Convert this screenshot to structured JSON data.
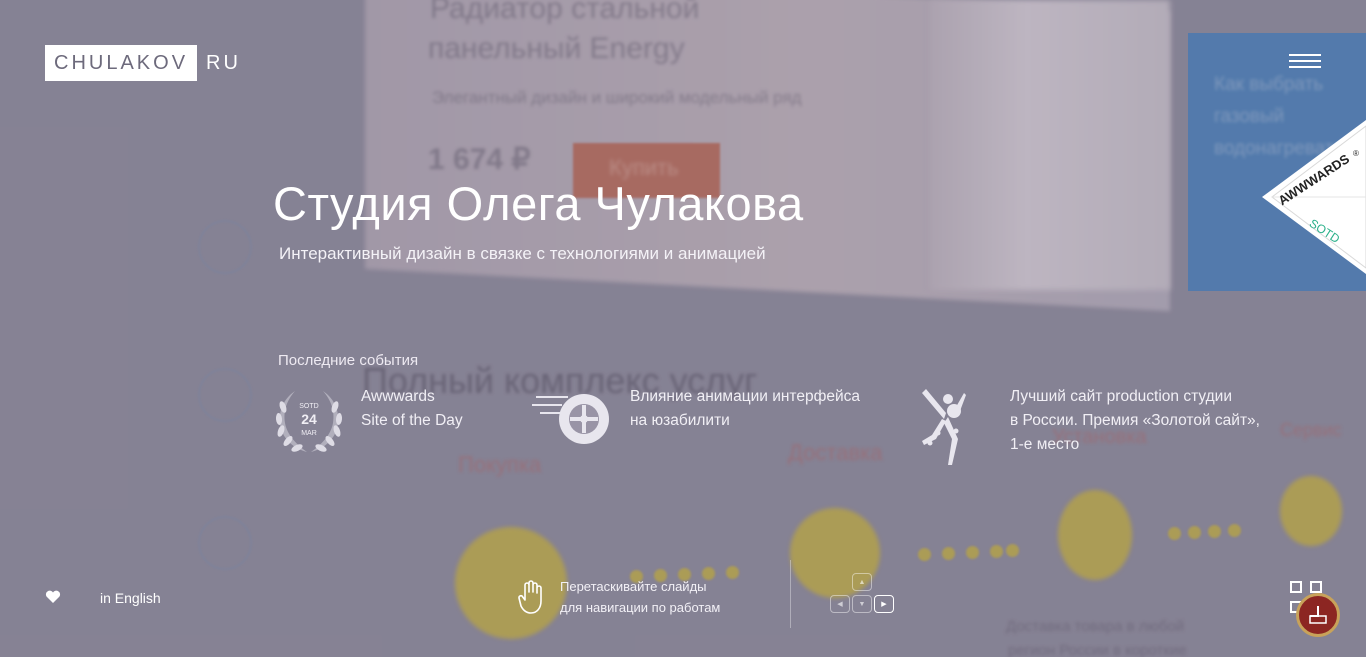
{
  "header": {
    "logo_main": "CHULAKOV",
    "logo_suffix": "RU"
  },
  "badge": {
    "brand": "AWWWARDS",
    "tag": "SOTD",
    "reg": "®"
  },
  "hero": {
    "title": "Студия Олега Чулакова",
    "subtitle": "Интерактивный дизайн в связке с технологиями и анимацией"
  },
  "events": {
    "label": "Последние события",
    "items": [
      {
        "line1": "Awwwards",
        "line2": "Site of the Day",
        "line3": "",
        "icon": "laurel-icon",
        "laurel_top": "SOTD",
        "laurel_day": "24",
        "laurel_month": "MAR"
      },
      {
        "line1": "Влияние анимации интерфейса",
        "line2": "на юзабилити",
        "line3": "",
        "icon": "speeding-wheel-icon"
      },
      {
        "line1": "Лучший сайт production студии",
        "line2": "в России. Премия «Золотой сайт»,",
        "line3": "1-е место",
        "icon": "dancer-figure-icon"
      }
    ]
  },
  "footer": {
    "lang": "in English",
    "hint_line1": "Перетаскивайте слайды",
    "hint_line2": "для навигации по работам"
  },
  "background": {
    "card_title1": "Радиатор стальной",
    "card_title2": "панельный Energy",
    "card_desc": "Элегантный дизайн и широкий модельный ряд",
    "price": "1 674 ₽",
    "buy": "Купить",
    "blue_text1": "Как выбрать",
    "blue_text2": "газовый",
    "blue_text3": "водонагреватель",
    "services": "Полный комплекс услуг",
    "step1": "Покупка",
    "step2": "Доставка",
    "step3": "Установка",
    "step4": "Сервис",
    "delivery1": "Доставка товара в любой",
    "delivery2": "регион России в короткие"
  },
  "colors": {
    "accent_gold": "#c7b23a",
    "accent_blue": "#3f7fbe",
    "awwwards_green": "#2bb08a"
  }
}
